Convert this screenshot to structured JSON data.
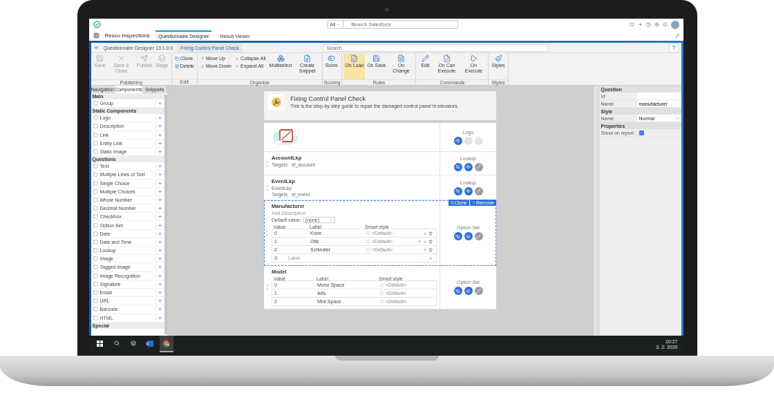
{
  "header": {
    "search_scope": "All",
    "search_placeholder": "Search Salesforce"
  },
  "nav": {
    "app_name": "Resco Inspections",
    "tabs": [
      {
        "label": "Questionnaire Designer",
        "selected": true
      },
      {
        "label": "Result Viewer",
        "selected": false
      }
    ]
  },
  "designer": {
    "title": "Questionnaire Designer 13.1.0.0",
    "document_tab": "Fixing Control Panel Check",
    "search_placeholder": "Search",
    "help": "?"
  },
  "ribbon": [
    {
      "label": "Publishing",
      "items": [
        {
          "label": "Save",
          "kind": "large",
          "disabled": true,
          "selected": false
        },
        {
          "label": "Save & Close",
          "kind": "large",
          "disabled": true,
          "selected": false
        },
        {
          "label": "Publish",
          "kind": "large",
          "disabled": true,
          "selected": false
        },
        {
          "label": "Stage",
          "kind": "large",
          "disabled": true,
          "selected": false
        }
      ]
    },
    {
      "label": "Edit",
      "items": [
        {
          "label": "Clone",
          "kind": "small",
          "disabled": false,
          "selected": false
        },
        {
          "label": "Delete",
          "kind": "small",
          "disabled": false,
          "selected": false
        }
      ]
    },
    {
      "label": "Organize",
      "items": [
        {
          "label": "Move Up",
          "kind": "small",
          "disabled": false,
          "selected": false
        },
        {
          "label": "Move Down",
          "kind": "small",
          "disabled": false,
          "selected": false
        },
        {
          "label": "Collapse All",
          "kind": "small",
          "disabled": false,
          "selected": false
        },
        {
          "label": "Expand All",
          "kind": "small",
          "disabled": false,
          "selected": false
        },
        {
          "label": "Multiselect",
          "kind": "large",
          "disabled": false,
          "selected": false
        },
        {
          "label": "Create Snippet",
          "kind": "large",
          "disabled": false,
          "selected": false
        }
      ]
    },
    {
      "label": "Scoring",
      "items": [
        {
          "label": "Score",
          "kind": "large",
          "disabled": false,
          "selected": false
        }
      ]
    },
    {
      "label": "Rules",
      "items": [
        {
          "label": "On Load",
          "kind": "large",
          "disabled": false,
          "selected": true
        },
        {
          "label": "On Save",
          "kind": "large",
          "disabled": false,
          "selected": false
        },
        {
          "label": "On Change",
          "kind": "large",
          "disabled": false,
          "selected": false
        }
      ]
    },
    {
      "label": "Commands",
      "items": [
        {
          "label": "Edit",
          "kind": "large",
          "disabled": false,
          "selected": false
        },
        {
          "label": "On Can Execute",
          "kind": "large",
          "disabled": false,
          "selected": false
        },
        {
          "label": "On Execute",
          "kind": "large",
          "disabled": false,
          "selected": false
        }
      ]
    },
    {
      "label": "Styles",
      "items": [
        {
          "label": "Styles",
          "kind": "large",
          "disabled": false,
          "selected": false
        }
      ]
    }
  ],
  "left_panel": {
    "tabs": [
      {
        "label": "Navigation",
        "selected": false
      },
      {
        "label": "Components",
        "selected": true
      },
      {
        "label": "Snippets",
        "selected": false
      }
    ],
    "sections": [
      {
        "title": "Main",
        "items": [
          "Group"
        ]
      },
      {
        "title": "Static Components",
        "items": [
          "Logo",
          "Description",
          "Link",
          "Entity Link",
          "Static Image"
        ]
      },
      {
        "title": "Questions",
        "items": [
          "Text",
          "Multiple Lines of Text",
          "Single Choice",
          "Multiple Choices",
          "Whole Number",
          "Decimal Number",
          "Checkbox",
          "Option Set",
          "Date",
          "Date and Time",
          "Lookup",
          "Image",
          "Tagged Image",
          "Image Recognition",
          "Signature",
          "Email",
          "URL",
          "Barcode",
          "HTML"
        ]
      },
      {
        "title": "Special"
      }
    ]
  },
  "form": {
    "title": "Fixing Control Panel Check",
    "description": "This is the step-by-step guide to repair the damaged control panel in elevators.",
    "questions": [
      {
        "type_label": "Logo",
        "selected": false,
        "actions": [
          {
            "kind": "visible"
          },
          {
            "kind": "empty"
          },
          {
            "kind": "empty"
          }
        ]
      },
      {
        "kind": "lookup",
        "name": "AccountLkp",
        "targets_label": "Targets",
        "targets": "sf_account",
        "type_label": "Lookup",
        "selected": false,
        "actions": [
          {
            "kind": "hide"
          },
          {
            "kind": "visible"
          },
          {
            "kind": "edit"
          }
        ]
      },
      {
        "kind": "lookup",
        "name": "EventLkp",
        "label": "EventLkp",
        "targets_label": "Targets",
        "targets": "sf_event",
        "type_label": "Lookup",
        "selected": false,
        "actions": [
          {
            "kind": "hide"
          },
          {
            "kind": "visible"
          },
          {
            "kind": "edit"
          }
        ]
      },
      {
        "kind": "option_set",
        "name": "Manufacturer",
        "description_placeholder": "Add Description",
        "default_label": "Default value:",
        "default_value": "(none)",
        "columns": [
          "Value",
          "Label",
          "Smart style"
        ],
        "rows": [
          {
            "value": "0",
            "label": "Kone",
            "style": "<Default>"
          },
          {
            "value": "1",
            "label": "Otis",
            "style": "<Default>"
          },
          {
            "value": "2",
            "label": "Schindler",
            "style": "<Default>"
          }
        ],
        "new_row": {
          "value": "3",
          "placeholder": "Label"
        },
        "type_label": "Option Set",
        "selected": true,
        "tools": [
          "Clone",
          "Remove"
        ],
        "actions": [
          {
            "kind": "hide"
          },
          {
            "kind": "visible"
          },
          {
            "kind": "edit"
          }
        ]
      },
      {
        "kind": "option_set",
        "name": "Model",
        "columns": [
          "Value",
          "Label",
          "Smart style"
        ],
        "rows": [
          {
            "value": "0",
            "label": "Mono Space",
            "style": "<Default>"
          },
          {
            "value": "1",
            "label": "Alfa",
            "style": "<Default>"
          },
          {
            "value": "2",
            "label": "Mini Space",
            "style": "<Default>"
          }
        ],
        "type_label": "Option Set",
        "selected": false,
        "actions": [
          {
            "kind": "hide"
          },
          {
            "kind": "visible"
          },
          {
            "kind": "edit"
          }
        ]
      }
    ]
  },
  "properties": [
    {
      "title": "Question",
      "rows": [
        {
          "label": "Id",
          "kind": "text"
        },
        {
          "label": "Name",
          "kind": "text",
          "value": "manufacturer"
        }
      ]
    },
    {
      "title": "Style",
      "rows": [
        {
          "label": "Name",
          "kind": "select",
          "value": "Normal"
        }
      ]
    },
    {
      "title": "Properties",
      "rows": [
        {
          "label": "Show on report",
          "kind": "checkbox",
          "checked": true
        }
      ]
    }
  ],
  "taskbar": {
    "apps": [
      {
        "kind": "outlook",
        "selected": false
      },
      {
        "kind": "chrome",
        "selected": true
      }
    ],
    "time": "10:27",
    "date": "3. 2. 2020"
  }
}
